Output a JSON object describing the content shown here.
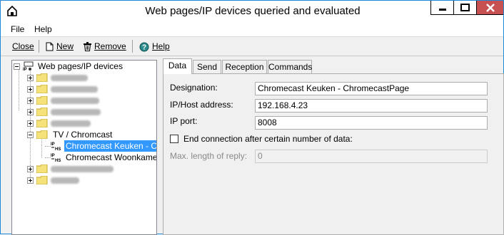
{
  "window": {
    "title": "Web pages/IP devices queried and evaluated"
  },
  "menu": {
    "items": [
      "File",
      "Help"
    ]
  },
  "toolbar": {
    "close_label": "Close",
    "new_label": "New",
    "remove_label": "Remove",
    "help_label": "Help"
  },
  "tree": {
    "root_label": "Web pages/IP devices",
    "group_label": "TV / Chromcast",
    "leaves": [
      "Chromecast Keuken - Chro",
      "Chromecast Woonkamer -"
    ]
  },
  "tabs": [
    "Data",
    "Send",
    "Reception",
    "Commands"
  ],
  "data_tab": {
    "designation_label": "Designation:",
    "designation_value": "Chromecast Keuken - ChromecastPage",
    "host_label": "IP/Host address:",
    "host_value": "192.168.4.23",
    "port_label": "IP port:",
    "port_value": "8008",
    "end_connection_label": "End connection after certain number of data:",
    "end_connection_checked": false,
    "max_length_label": "Max. length of reply:",
    "max_length_value": "0"
  },
  "icons": {
    "app": "house-icon",
    "new": "document-icon",
    "remove": "trash-icon",
    "help": "help-circle-icon",
    "folder": "folder-icon",
    "device": "ip-device-icon"
  },
  "colors": {
    "selection": "#3399FF",
    "close_button": "#C75050",
    "window_border": "#1F89D6",
    "folder": "#F5E27A"
  }
}
